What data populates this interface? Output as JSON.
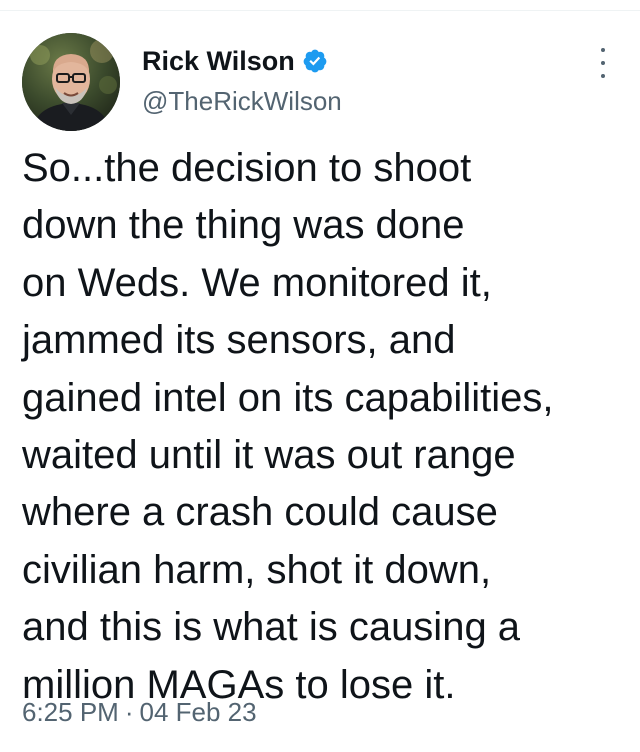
{
  "author": {
    "display_name": "Rick Wilson",
    "handle": "@TheRickWilson",
    "verified": true,
    "verified_color": "#1d9bf0"
  },
  "tweet": {
    "lines": [
      "So...the decision to shoot",
      "down the thing was done",
      "on Weds. We monitored it,",
      "jammed its sensors, and",
      "gained intel on its capabilities,",
      "waited until it was out range",
      "where a crash could cause",
      "civilian harm, shot it down,",
      "and this is what is causing a",
      "million MAGAs to lose it."
    ],
    "time": "6:25 PM",
    "separator": "·",
    "date": "04 Feb 23"
  },
  "icons": {
    "verified": "verified-badge-icon",
    "more": "more-options-icon"
  },
  "colors": {
    "text": "#0f1419",
    "secondary": "#536471"
  }
}
